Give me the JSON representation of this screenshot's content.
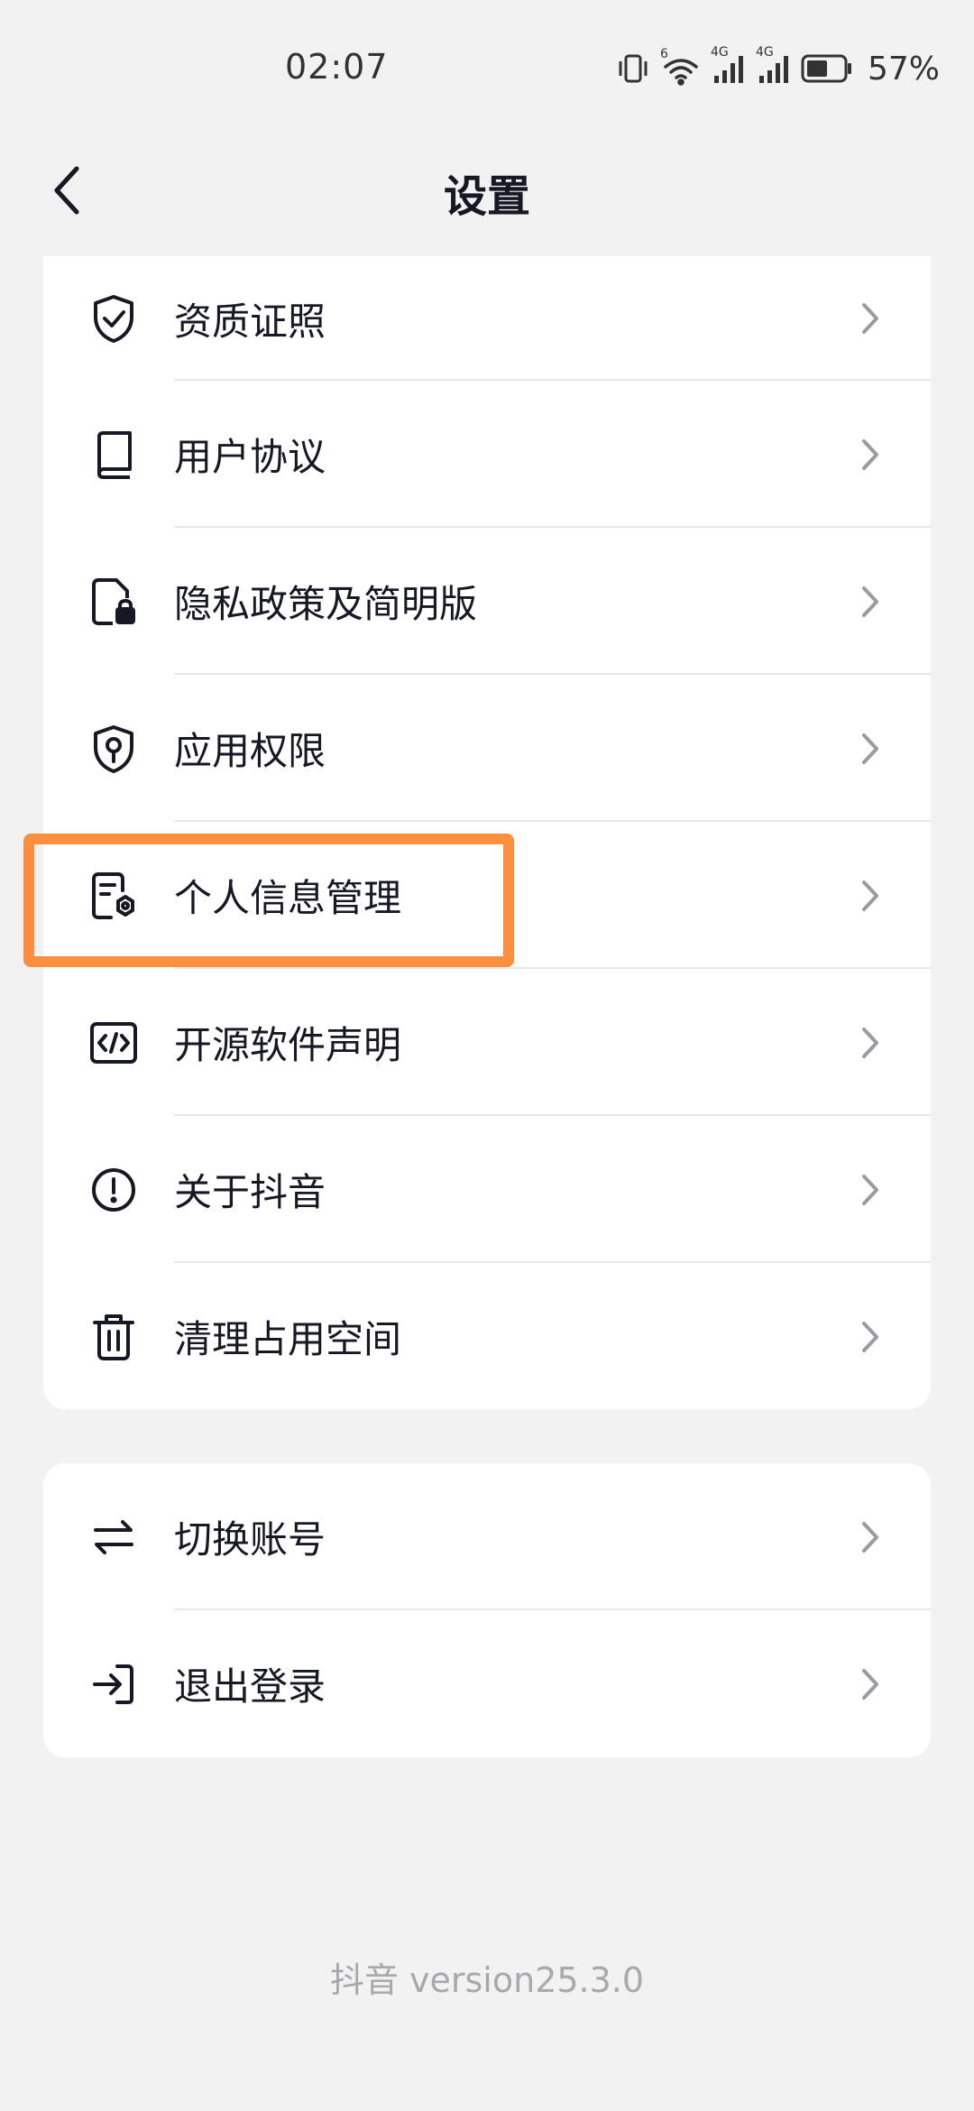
{
  "status": {
    "time": "02:07",
    "battery": "57%",
    "network_1": "4G",
    "network_2": "4G",
    "wifi_badge": "6"
  },
  "nav": {
    "title": "设置"
  },
  "settings_items": [
    {
      "label": "资质证照",
      "icon": "shield-check-icon"
    },
    {
      "label": "用户协议",
      "icon": "book-icon"
    },
    {
      "label": "隐私政策及简明版",
      "icon": "document-lock-icon"
    },
    {
      "label": "应用权限",
      "icon": "shield-person-icon"
    },
    {
      "label": "个人信息管理",
      "icon": "document-settings-icon"
    },
    {
      "label": "开源软件声明",
      "icon": "code-icon"
    },
    {
      "label": "关于抖音",
      "icon": "info-circle-icon"
    },
    {
      "label": "清理占用空间",
      "icon": "trash-icon"
    }
  ],
  "account_items": [
    {
      "label": "切换账号",
      "icon": "switch-arrows-icon"
    },
    {
      "label": "退出登录",
      "icon": "logout-icon"
    }
  ],
  "footer": {
    "version": "抖音 version25.3.0"
  },
  "colors": {
    "highlight": "#fb8f3e",
    "background": "#f2f2f2",
    "card": "#ffffff",
    "text": "#161823"
  }
}
